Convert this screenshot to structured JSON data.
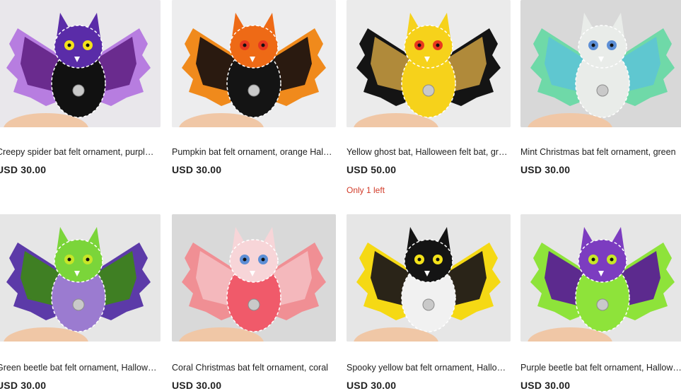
{
  "listings": [
    {
      "title": "Creepy spider bat felt ornament, purple Halloween decor",
      "price": "USD 30.00",
      "stock": "",
      "colors": {
        "bg": "#e9e7eb",
        "body": "#111111",
        "head": "#5a2ca8",
        "wing": "#b77de0",
        "wing_inner": "#6a2b8e",
        "stitch": "#ffffff",
        "eyes": "#f3e21a"
      }
    },
    {
      "title": "Pumpkin bat felt ornament, orange Halloween decor",
      "price": "USD 30.00",
      "stock": "",
      "colors": {
        "bg": "#ededee",
        "body": "#141414",
        "head": "#ee6a16",
        "wing": "#f08a1c",
        "wing_inner": "#2a1a10",
        "stitch": "#ffffff",
        "eyes": "#e8371f"
      }
    },
    {
      "title": "Yellow ghost bat, Halloween felt bat, gray",
      "price": "USD 50.00",
      "stock": "Only 1 left",
      "colors": {
        "bg": "#ebebeb",
        "body": "#f6d21b",
        "head": "#f6d21b",
        "wing": "#141414",
        "wing_inner": "#b08a3a",
        "stitch": "#ffffff",
        "eyes": "#e8371f"
      }
    },
    {
      "title": "Mint Christmas bat felt ornament, green",
      "price": "USD 30.00",
      "stock": "",
      "colors": {
        "bg": "#d8d8d8",
        "body": "#e9ece9",
        "head": "#e9ece9",
        "wing": "#6fd9a8",
        "wing_inner": "#5fc7d0",
        "stitch": "#ffffff",
        "eyes": "#5d8fd6"
      }
    },
    {
      "title": "Green beetle bat felt ornament, Halloween decor",
      "price": "USD 30.00",
      "stock": "",
      "colors": {
        "bg": "#e6e6e6",
        "body": "#9b7bd0",
        "head": "#7bd53a",
        "wing": "#5c3aa8",
        "wing_inner": "#3f7f23",
        "stitch": "#ffffff",
        "eyes": "#c7e628"
      }
    },
    {
      "title": "Coral Christmas bat felt ornament, coral",
      "price": "USD 30.00",
      "stock": "",
      "colors": {
        "bg": "#d9d9d9",
        "body": "#f05a6a",
        "head": "#f7d5d8",
        "wing": "#f08f94",
        "wing_inner": "#f4b8bc",
        "stitch": "#ffffff",
        "eyes": "#5d8fd6"
      }
    },
    {
      "title": "Spooky yellow bat felt ornament, Halloween",
      "price": "USD 30.00",
      "stock": "",
      "colors": {
        "bg": "#e6e6e6",
        "body": "#f1f1f1",
        "head": "#141414",
        "wing": "#f5d914",
        "wing_inner": "#2a2418",
        "stitch": "#ffffff",
        "eyes": "#f3e21a"
      }
    },
    {
      "title": "Purple beetle bat felt ornament, Halloween",
      "price": "USD 30.00",
      "stock": "",
      "colors": {
        "bg": "#e6e6e6",
        "body": "#8ee33a",
        "head": "#7c3cc0",
        "wing": "#8ee33a",
        "wing_inner": "#5c2a8e",
        "stitch": "#ffffff",
        "eyes": "#c7e628"
      }
    }
  ]
}
